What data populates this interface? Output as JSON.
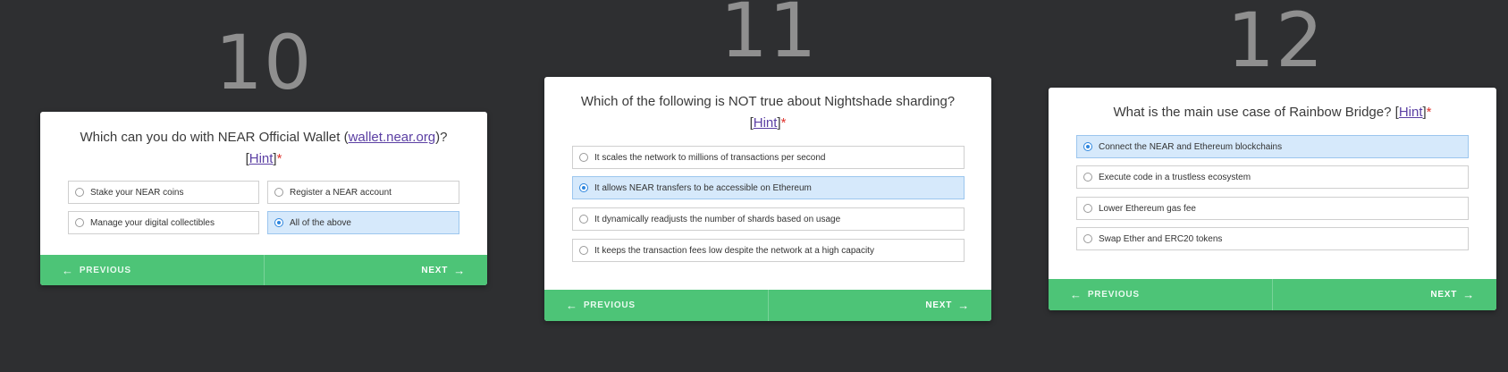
{
  "cards": [
    {
      "number": "10",
      "question_prefix": "Which can you do with NEAR Official Wallet (",
      "question_link": "wallet.near.org",
      "question_suffix": ")?",
      "hint_open": "[",
      "hint": "Hint",
      "hint_close": "]",
      "required": "*",
      "options": [
        {
          "label": "Stake your NEAR coins",
          "selected": false
        },
        {
          "label": "Register a NEAR account",
          "selected": false
        },
        {
          "label": "Manage your digital collectibles",
          "selected": false
        },
        {
          "label": "All of the above",
          "selected": true
        }
      ],
      "prev_label": "PREVIOUS",
      "next_label": "NEXT"
    },
    {
      "number": "11",
      "question": "Which of the following is NOT true about Nightshade sharding?",
      "hint_open": "[",
      "hint": "Hint",
      "hint_close": "]",
      "required": "*",
      "options": [
        {
          "label": "It scales the network to millions of transactions per second",
          "selected": false
        },
        {
          "label": "It allows NEAR transfers to be accessible on Ethereum",
          "selected": true
        },
        {
          "label": "It dynamically readjusts the number of shards based on usage",
          "selected": false
        },
        {
          "label": "It keeps the transaction fees low despite the network at a high capacity",
          "selected": false
        }
      ],
      "prev_label": "PREVIOUS",
      "next_label": "NEXT"
    },
    {
      "number": "12",
      "question": "What is the main use case of Rainbow Bridge?",
      "hint_open": "[",
      "hint": "Hint",
      "hint_close": "]",
      "required": "*",
      "options": [
        {
          "label": "Connect the NEAR and Ethereum blockchains",
          "selected": true
        },
        {
          "label": "Execute code in a trustless ecosystem",
          "selected": false
        },
        {
          "label": "Lower Ethereum gas fee",
          "selected": false
        },
        {
          "label": "Swap Ether and ERC20 tokens",
          "selected": false
        }
      ],
      "prev_label": "PREVIOUS",
      "next_label": "NEXT"
    }
  ],
  "icons": {
    "prev": "arrow-left-icon",
    "next": "arrow-right-icon",
    "radio_selected_color": "#2e86de"
  },
  "colors": {
    "background": "#2e2f31",
    "footer": "#4dc477",
    "selected_option": "#d6e9fb",
    "link": "#5b3fa3",
    "required": "#e0342e"
  }
}
